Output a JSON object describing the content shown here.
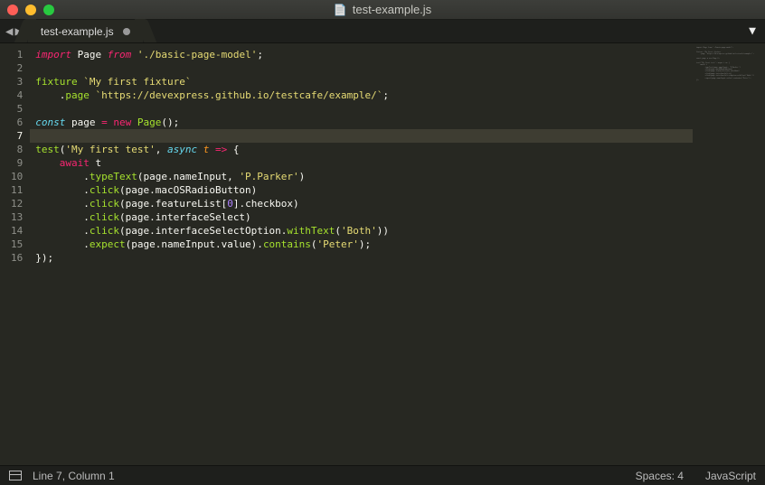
{
  "window": {
    "title": "test-example.js"
  },
  "tab": {
    "name": "test-example.js",
    "dirty": true
  },
  "gutter": {
    "lines": [
      "1",
      "2",
      "3",
      "4",
      "5",
      "6",
      "7",
      "8",
      "9",
      "10",
      "11",
      "12",
      "13",
      "14",
      "15",
      "16"
    ],
    "current": 7
  },
  "code": {
    "lines": [
      [
        [
          "k",
          "import"
        ],
        [
          "p",
          " "
        ],
        [
          "id",
          "Page"
        ],
        [
          "p",
          " "
        ],
        [
          "k",
          "from"
        ],
        [
          "p",
          " "
        ],
        [
          "s",
          "'./basic-page-model'"
        ],
        [
          "p",
          ";"
        ]
      ],
      [],
      [
        [
          "fn",
          "fixture"
        ],
        [
          "p",
          " "
        ],
        [
          "s",
          "`My first fixture`"
        ]
      ],
      [
        [
          "p",
          "    ."
        ],
        [
          "fn",
          "page"
        ],
        [
          "p",
          " "
        ],
        [
          "s",
          "`https://devexpress.github.io/testcafe/example/`"
        ],
        [
          "p",
          ";"
        ]
      ],
      [],
      [
        [
          "st",
          "const"
        ],
        [
          "p",
          " "
        ],
        [
          "id",
          "page"
        ],
        [
          "p",
          " "
        ],
        [
          "op",
          "="
        ],
        [
          "p",
          " "
        ],
        [
          "kp",
          "new"
        ],
        [
          "p",
          " "
        ],
        [
          "cls",
          "Page"
        ],
        [
          "p",
          "();"
        ]
      ],
      [],
      [
        [
          "fn",
          "test"
        ],
        [
          "p",
          "("
        ],
        [
          "s",
          "'My first test'"
        ],
        [
          "p",
          ", "
        ],
        [
          "st",
          "async"
        ],
        [
          "p",
          " "
        ],
        [
          "prm",
          "t"
        ],
        [
          "p",
          " "
        ],
        [
          "op",
          "=>"
        ],
        [
          "p",
          " {"
        ]
      ],
      [
        [
          "p",
          "    "
        ],
        [
          "kp",
          "await"
        ],
        [
          "p",
          " t"
        ]
      ],
      [
        [
          "p",
          "        ."
        ],
        [
          "fn",
          "typeText"
        ],
        [
          "p",
          "(page.nameInput, "
        ],
        [
          "s",
          "'P.Parker'"
        ],
        [
          "p",
          ")"
        ]
      ],
      [
        [
          "p",
          "        ."
        ],
        [
          "fn",
          "click"
        ],
        [
          "p",
          "(page.macOSRadioButton)"
        ]
      ],
      [
        [
          "p",
          "        ."
        ],
        [
          "fn",
          "click"
        ],
        [
          "p",
          "(page.featureList["
        ],
        [
          "n",
          "0"
        ],
        [
          "p",
          "].checkbox)"
        ]
      ],
      [
        [
          "p",
          "        ."
        ],
        [
          "fn",
          "click"
        ],
        [
          "p",
          "(page.interfaceSelect)"
        ]
      ],
      [
        [
          "p",
          "        ."
        ],
        [
          "fn",
          "click"
        ],
        [
          "p",
          "(page.interfaceSelectOption."
        ],
        [
          "fn",
          "withText"
        ],
        [
          "p",
          "("
        ],
        [
          "s",
          "'Both'"
        ],
        [
          "p",
          "))"
        ]
      ],
      [
        [
          "p",
          "        ."
        ],
        [
          "fn",
          "expect"
        ],
        [
          "p",
          "(page.nameInput.value)."
        ],
        [
          "fn",
          "contains"
        ],
        [
          "p",
          "("
        ],
        [
          "s",
          "'Peter'"
        ],
        [
          "p",
          ");"
        ]
      ],
      [
        [
          "p",
          "});"
        ]
      ]
    ]
  },
  "status": {
    "position": "Line 7, Column 1",
    "spaces": "Spaces: 4",
    "language": "JavaScript"
  }
}
